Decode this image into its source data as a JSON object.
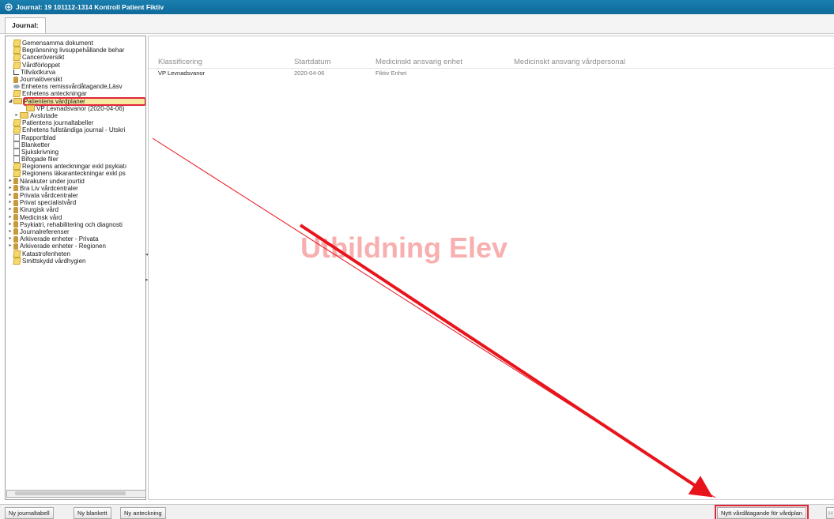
{
  "window": {
    "title": "Journal: 19 101112-1314 Kontroll Patient Fiktiv"
  },
  "tabs": [
    {
      "label": "Journal:"
    }
  ],
  "sidebar": {
    "items": [
      {
        "label": "Gemensamma dokument",
        "icon": "note-folder-icon"
      },
      {
        "label": "Begränsning livsuppehållande behar",
        "icon": "note-folder-icon"
      },
      {
        "label": "Canceröversikt",
        "icon": "note-folder-icon"
      },
      {
        "label": "Vårdförloppet",
        "icon": "note-folder-icon"
      },
      {
        "label": "Tillväxtkurva",
        "icon": "chart-icon"
      },
      {
        "label": "Journalöversikt",
        "icon": "person-icon"
      },
      {
        "label": "Enhetens remissvårdåtagande,Läsv",
        "icon": "eye-icon"
      },
      {
        "label": "Enhetens anteckningar",
        "icon": "note-folder-icon"
      },
      {
        "label": "Patientens vårdplaner",
        "icon": "folder-icon",
        "expanded": true,
        "highlighted": true
      },
      {
        "label": "VP Levnadsvanor (2020-04-06)",
        "icon": "folder-icon",
        "indent": 2
      },
      {
        "label": "Avslutade",
        "icon": "folder-icon",
        "indent": 1,
        "collapsed": true
      },
      {
        "label": "Patientens journaltabeller",
        "icon": "note-folder-icon"
      },
      {
        "label": "Enhetens fullständiga journal - Utskri",
        "icon": "note-folder-icon"
      },
      {
        "label": "Rapportblad",
        "icon": "doc-icon"
      },
      {
        "label": "Blanketter",
        "icon": "doc-icon"
      },
      {
        "label": "Sjukskrivning",
        "icon": "doc-icon"
      },
      {
        "label": "Bifogade filer",
        "icon": "doc-icon"
      },
      {
        "label": "Regionens anteckningar exkl psykiatı",
        "icon": "note-folder-icon"
      },
      {
        "label": "Regionens läkaranteckningar exkl ps",
        "icon": "note-folder-icon"
      },
      {
        "label": "Närakuter under jourtid",
        "icon": "hand-icon",
        "collapsed": true
      },
      {
        "label": "Bra Liv vårdcentraler",
        "icon": "hand-icon",
        "collapsed": true
      },
      {
        "label": "Privata vårdcentraler",
        "icon": "hand-icon",
        "collapsed": true
      },
      {
        "label": "Privat specialistvård",
        "icon": "hand-icon",
        "collapsed": true
      },
      {
        "label": "Kirurgisk vård",
        "icon": "hand-icon",
        "collapsed": true
      },
      {
        "label": "Medicinsk vård",
        "icon": "hand-icon",
        "collapsed": true
      },
      {
        "label": "Psykiatri, rehabilitering och diagnosti",
        "icon": "hand-icon",
        "collapsed": true
      },
      {
        "label": "Journalreferenser",
        "icon": "hand-icon",
        "collapsed": true
      },
      {
        "label": "Arkiverade enheter - Privata",
        "icon": "hand-icon",
        "collapsed": true
      },
      {
        "label": "Arkiverade enheter - Regionen",
        "icon": "hand-icon",
        "collapsed": true
      },
      {
        "label": "Katastrofenheten",
        "icon": "note-folder-icon"
      },
      {
        "label": "Smittskydd vårdhygien",
        "icon": "note-folder-icon"
      }
    ]
  },
  "table": {
    "columns": [
      "Klassificering",
      "Startdatum",
      "Medicinskt ansvarig enhet",
      "Medicinskt ansvarig vårdpersonal"
    ],
    "rows": [
      [
        "VP Levnadsvanor",
        "2020-04-06",
        "Fiktiv Enhet",
        ""
      ]
    ]
  },
  "watermark": "Utbildning Elev",
  "bottom": {
    "buttons": [
      "Ny journaltabell",
      "Ny blankett",
      "Ny anteckning"
    ],
    "primary_button": "Nytt vårdåtagande för vårdplan",
    "trailing_label": "H"
  },
  "colors": {
    "titlebar": "#1a7fb0",
    "highlight": "#e0263a",
    "arrow": "#e8141c"
  }
}
